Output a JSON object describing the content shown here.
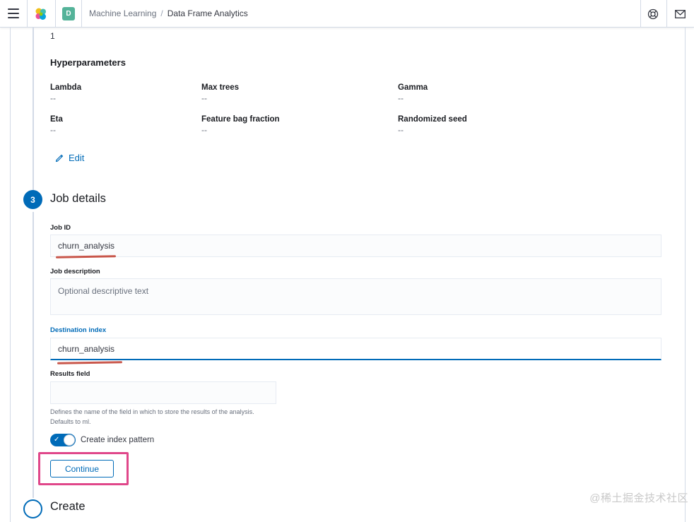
{
  "header": {
    "space_initial": "D",
    "breadcrumbs": [
      "Machine Learning",
      "Data Frame Analytics"
    ],
    "separator": "/"
  },
  "summary": {
    "previous_value": "1"
  },
  "hyperparameters": {
    "title": "Hyperparameters",
    "params": [
      {
        "label": "Lambda",
        "value": "--"
      },
      {
        "label": "Max trees",
        "value": "--"
      },
      {
        "label": "Gamma",
        "value": "--"
      },
      {
        "label": "Eta",
        "value": "--"
      },
      {
        "label": "Feature bag fraction",
        "value": "--"
      },
      {
        "label": "Randomized seed",
        "value": "--"
      }
    ],
    "edit_label": "Edit"
  },
  "job_details": {
    "step_number": "3",
    "title": "Job details",
    "job_id_label": "Job ID",
    "job_id_value": "churn_analysis",
    "job_description_label": "Job description",
    "job_description_placeholder": "Optional descriptive text",
    "destination_index_label": "Destination index",
    "destination_index_value": "churn_analysis",
    "results_field_label": "Results field",
    "results_field_value": "",
    "results_field_help": "Defines the name of the field in which to store the results of the analysis. Defaults to ml.",
    "create_index_pattern_label": "Create index pattern",
    "create_index_pattern_enabled": true,
    "continue_label": "Continue"
  },
  "next_step": {
    "title": "Create"
  },
  "watermark": "@稀土掘金技术社区",
  "colors": {
    "primary": "#006bb8",
    "annotation_highlight": "#e0478a",
    "annotation_underline": "#c0392b"
  }
}
